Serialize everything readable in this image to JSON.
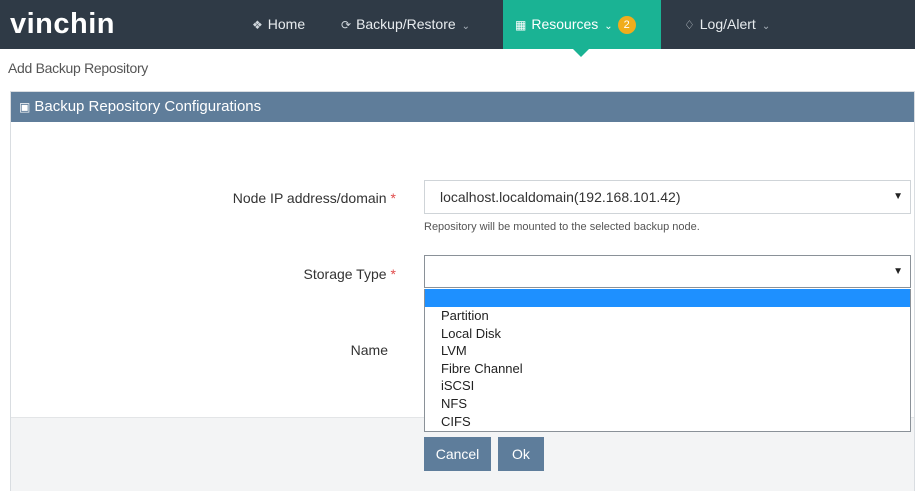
{
  "app": {
    "logo": "vinchin"
  },
  "nav": {
    "home": {
      "label": "Home",
      "icon": "home-icon"
    },
    "backup": {
      "label": "Backup/Restore",
      "icon": "refresh-icon"
    },
    "resources": {
      "label": "Resources",
      "icon": "grid-icon",
      "badge": "2",
      "active": true
    },
    "log": {
      "label": "Log/Alert",
      "icon": "bell-icon"
    }
  },
  "breadcrumb": "Add Backup Repository",
  "panel": {
    "title": "Backup Repository Configurations",
    "icon": "gift-icon"
  },
  "form": {
    "node": {
      "label": "Node IP address/domain",
      "required": "*",
      "value": "localhost.localdomain(192.168.101.42)",
      "hint": "Repository will be mounted to the selected backup node."
    },
    "storage": {
      "label": "Storage Type",
      "required": "*",
      "value": "",
      "options": [
        "",
        "Partition",
        "Local Disk",
        "LVM",
        "Fibre Channel",
        "iSCSI",
        "NFS",
        "CIFS"
      ],
      "highlighted_index": 0
    },
    "name": {
      "label": "Name"
    }
  },
  "buttons": {
    "cancel": "Cancel",
    "ok": "Ok"
  },
  "colors": {
    "topbar": "#2f3a46",
    "accent": "#1ab394",
    "badge": "#f0ad1c",
    "panel_header": "#5f7d9a",
    "button": "#5e7d9b",
    "highlight": "#1e90ff"
  }
}
